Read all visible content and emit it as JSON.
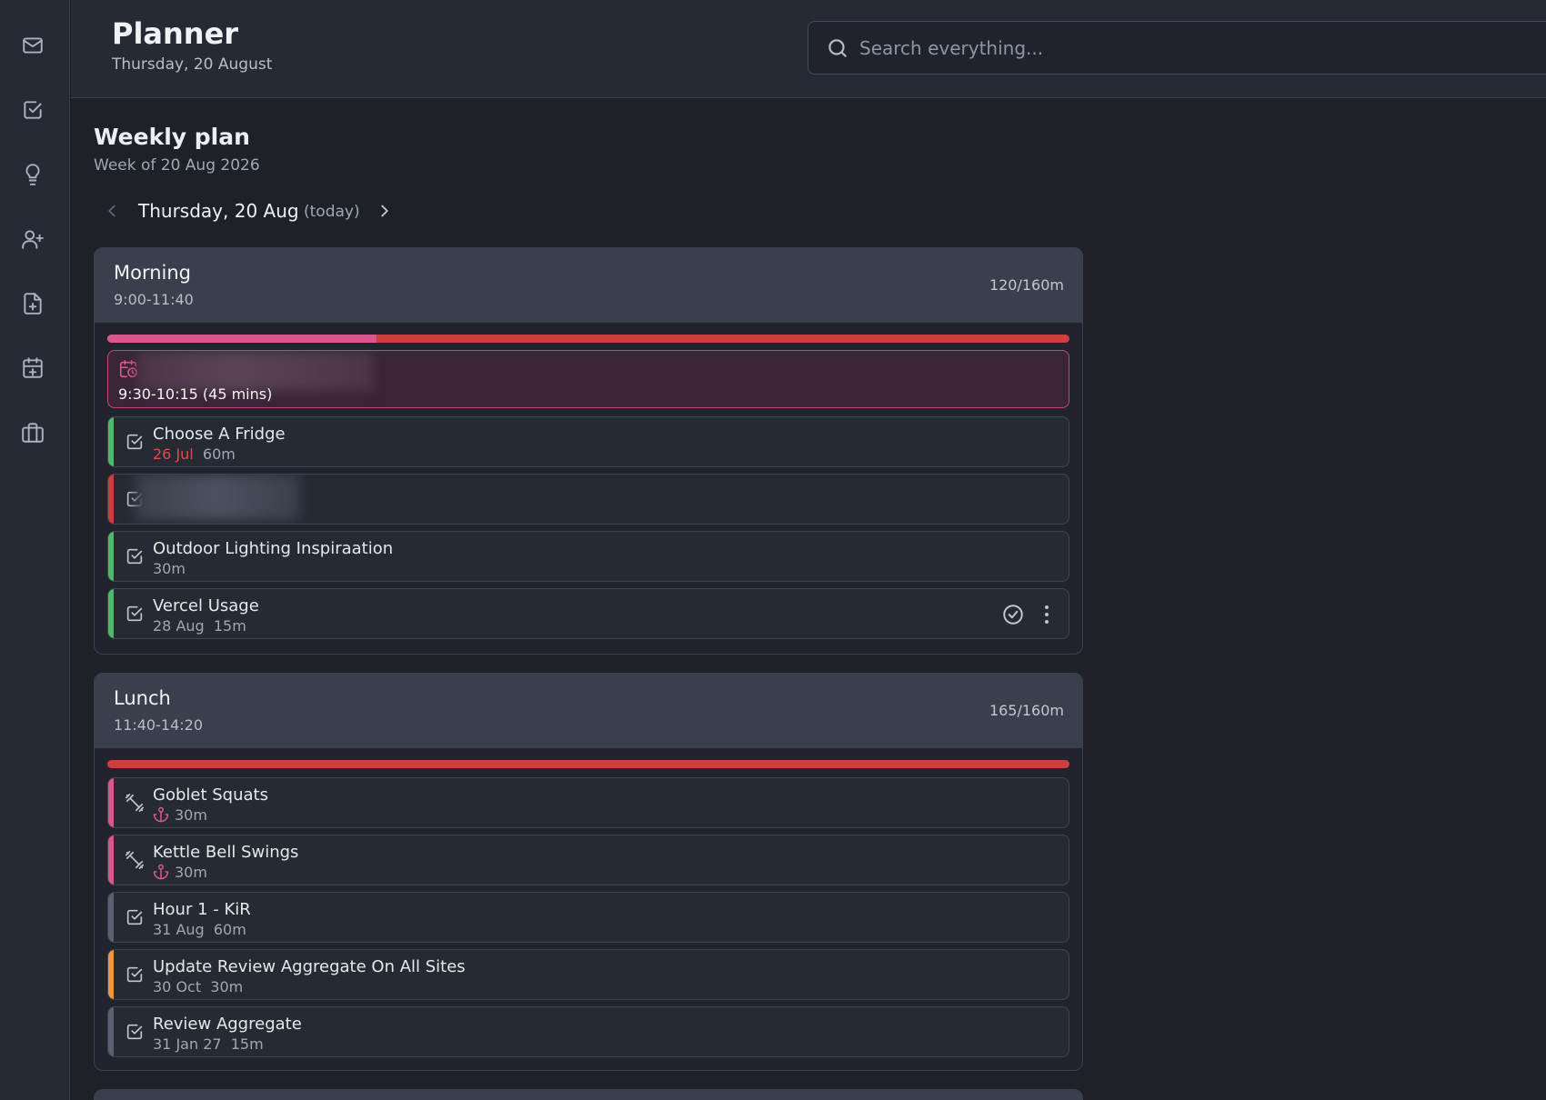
{
  "app": {
    "title": "Planner",
    "date": "Thursday, 20 August"
  },
  "search": {
    "placeholder": "Search everything..."
  },
  "sidebar": {
    "items": [
      {
        "icon": "mail-icon"
      },
      {
        "icon": "checkbox-icon"
      },
      {
        "icon": "lightbulb-icon"
      },
      {
        "icon": "user-plus-icon"
      },
      {
        "icon": "file-plus-icon"
      },
      {
        "icon": "calendar-plus-icon"
      },
      {
        "icon": "briefcase-icon"
      }
    ]
  },
  "weekly": {
    "title": "Weekly plan",
    "subtitle": "Week of 20 Aug 2026"
  },
  "day_nav": {
    "label": "Thursday, 20 Aug",
    "today": "(today)"
  },
  "colors": {
    "green": "#4fb86a",
    "red": "#cd3f3c",
    "pink": "#d9578f",
    "orange": "#e79b3a",
    "gray": "#596072"
  },
  "blocks": [
    {
      "name": "Morning",
      "time": "9:00-11:40",
      "capacity": "120/160m",
      "progress": 0.28,
      "event": {
        "time": "9:30-10:15 (45 mins)"
      },
      "tasks": [
        {
          "name": "Choose A Fridge",
          "due": "26 Jul",
          "duration": "60m",
          "stripe": "green"
        },
        {
          "stripe": "red"
        },
        {
          "name": "Outdoor Lighting Inspiraation",
          "due": "",
          "duration": "30m",
          "stripe": "green"
        },
        {
          "name": "Vercel Usage",
          "due": "28 Aug",
          "duration": "15m",
          "stripe": "green"
        }
      ]
    },
    {
      "name": "Lunch",
      "time": "11:40-14:20",
      "capacity": "165/160m",
      "progress": 0,
      "tasks": [
        {
          "name": "Goblet Squats",
          "duration": "30m",
          "stripe": "pink"
        },
        {
          "name": "Kettle Bell Swings",
          "duration": "30m",
          "stripe": "pink"
        },
        {
          "name": "Hour 1 - KiR",
          "due": "31 Aug",
          "duration": "60m",
          "stripe": "gray"
        },
        {
          "name": "Update Review Aggregate On All Sites",
          "due": "30 Oct",
          "duration": "30m",
          "stripe": "orange"
        },
        {
          "name": "Review Aggregate",
          "due": "31 Jan 27",
          "duration": "15m",
          "stripe": "gray"
        }
      ]
    }
  ]
}
